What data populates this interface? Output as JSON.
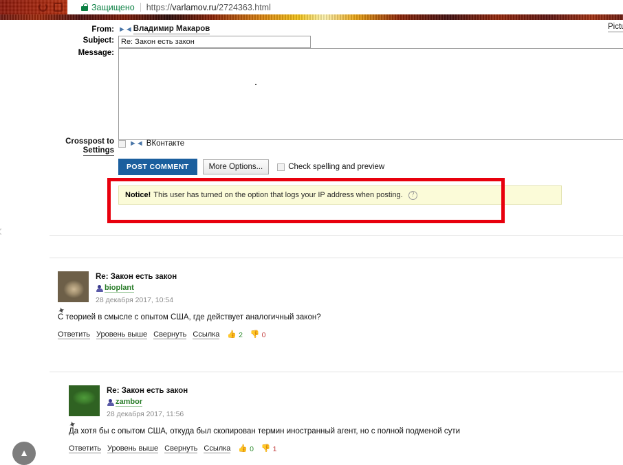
{
  "browser": {
    "secure_label": "Защищено",
    "url_scheme": "https://",
    "url_host": "varlamov.ru",
    "url_path": "/2724363.html",
    "reload_icon": "reload-icon",
    "home_icon": "home-icon",
    "lock_icon": "lock-icon",
    "secure_color": "#0b8043"
  },
  "form": {
    "from_label": "From:",
    "from_service_icon": "vk-icon",
    "from_name": "Владимир Макаров",
    "subject_label": "Subject:",
    "subject_value": "Re: Закон есть закон",
    "subject_placeholder": "",
    "message_label": "Message:",
    "message_value": "",
    "message_placeholder": "",
    "crosspost_label": "Crosspost to",
    "settings_label": "Settings",
    "crosspost_option": "ВКонтакте",
    "crosspost_icon": "vk-icon",
    "crosspost_checked": false,
    "post_button": "POST COMMENT",
    "post_button_color": "#1b5f9e",
    "more_options_button": "More Options...",
    "spellcheck_label": "Check spelling and preview",
    "spellcheck_checked": false,
    "pictures_link": "Pictu"
  },
  "notice": {
    "strong": "Notice!",
    "text": "This user has turned on the option that logs your IP address when posting.",
    "help_icon": "question-mark-icon",
    "help_glyph": "?",
    "background": "#fbfbd8",
    "border": "#e3e3b0"
  },
  "annotation": {
    "shape": "red-rectangle",
    "color": "#e8000d"
  },
  "comments": [
    {
      "avatar_icon": "avatar-hedgehog",
      "subject": "Re: Закон есть закон",
      "user_icon": "user-icon",
      "username": "bioplant",
      "date": "28 декабря 2017, 10:54",
      "pin_icon": "pin-icon",
      "pin_glyph": "📌",
      "body": "С теорией в смысле с опытом США, где действует аналогичный закон?",
      "actions": [
        "Ответить",
        "Уровень выше",
        "Свернуть",
        "Ссылка"
      ],
      "thumbs_up_icon": "thumbs-up-icon",
      "thumbs_up_glyph": "👍",
      "thumbs_up_count": "2",
      "thumbs_down_icon": "thumbs-down-icon",
      "thumbs_down_glyph": "👎",
      "thumbs_down_count": "0"
    },
    {
      "avatar_icon": "avatar-pepe",
      "subject": "Re: Закон есть закон",
      "user_icon": "user-icon",
      "username": "zambor",
      "date": "28 декабря 2017, 11:56",
      "pin_icon": "pin-icon",
      "pin_glyph": "📌",
      "body": "Да хотя бы с опытом США, откуда был скопирован термин иностранный агент, но с полной подменой сути",
      "actions": [
        "Ответить",
        "Уровень выше",
        "Свернуть",
        "Ссылка"
      ],
      "thumbs_up_icon": "thumbs-up-icon",
      "thumbs_up_glyph": "👍",
      "thumbs_up_count": "0",
      "thumbs_down_icon": "thumbs-down-icon",
      "thumbs_down_glyph": "👎",
      "thumbs_down_count": "1"
    }
  ],
  "floaters": {
    "prev_chevron_icon": "chevron-left-icon",
    "prev_chevron_glyph": "‹",
    "scroll_top_icon": "scroll-to-top-icon",
    "scroll_top_glyph": "▲"
  }
}
